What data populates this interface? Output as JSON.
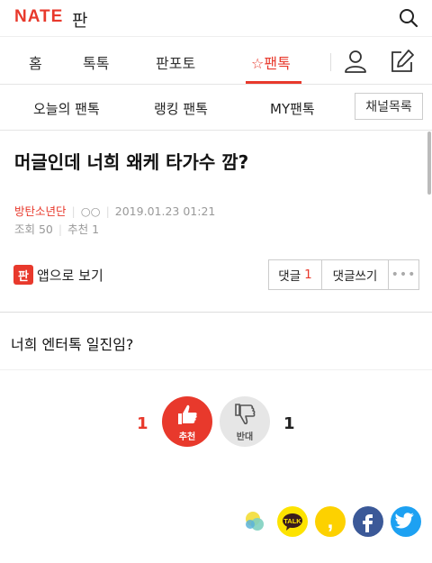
{
  "header": {
    "logo": "NATE",
    "section": "판"
  },
  "nav": {
    "items": [
      {
        "label": "홈"
      },
      {
        "label": "톡톡"
      },
      {
        "label": "판포토"
      },
      {
        "label": "☆팬톡"
      }
    ]
  },
  "subnav": {
    "items": [
      {
        "label": "오늘의 팬톡"
      },
      {
        "label": "랭킹 팬톡"
      },
      {
        "label": "MY팬톡"
      }
    ],
    "channel_button": "채널목록"
  },
  "post": {
    "title": "머글인데 너희 왜케 타가수 깜?",
    "author": "방탄소년단",
    "author_mark": "○○",
    "datetime": "2019.01.23 01:21",
    "views": "조회 50",
    "recommends": "추천 1",
    "body": "너희 엔터톡 일진임?"
  },
  "actions": {
    "app_badge": "판",
    "app_view": "앱으로 보기",
    "comments_label": "댓글",
    "comments_count": "1",
    "write_comment": "댓글쓰기",
    "more": "•••"
  },
  "vote": {
    "up_count": "1",
    "up_label": "추천",
    "down_label": "반대",
    "down_count": "1"
  },
  "share": {
    "kakao_talk_label": "TALK",
    "kakao_story_label": ","
  },
  "colors": {
    "accent": "#e8392c",
    "kakao": "#fde300",
    "facebook": "#3b5998",
    "twitter": "#1da1f2"
  }
}
